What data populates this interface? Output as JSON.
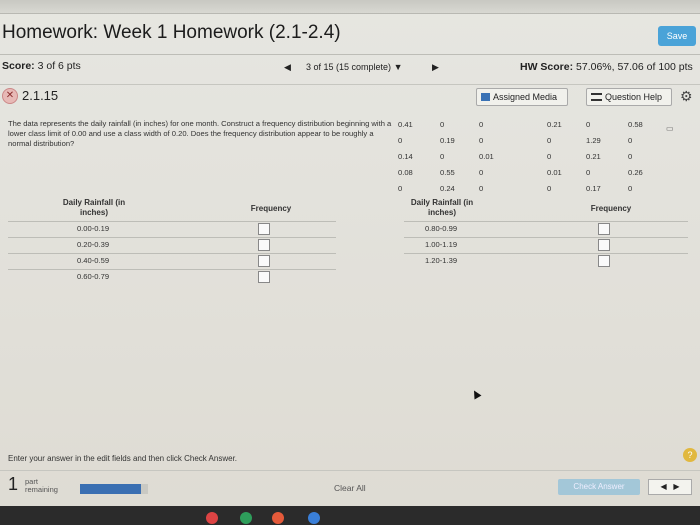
{
  "header": {
    "title": "Homework: Week 1 Homework (2.1-2.4)",
    "save_label": "Save"
  },
  "scorebar": {
    "score_label": "Score:",
    "score_value": "3 of 6 pts",
    "question_selector": "3 of 15 (15 complete)",
    "hw_score_label": "HW Score:",
    "hw_score_value": "57.06%, 57.06 of 100 pts"
  },
  "question_header": {
    "number": "2.1.15",
    "assigned_media_label": "Assigned Media",
    "question_help_label": "Question Help"
  },
  "question": {
    "text": "The data represents the daily rainfall (in inches) for one month. Construct a frequency distribution beginning with a lower class limit of 0.00 and use a class width of 0.20. Does the frequency distribution appear to be roughly a normal distribution?",
    "data_rows": [
      [
        "0.41",
        "0",
        "0",
        "0.21",
        "0",
        "0.58"
      ],
      [
        "0",
        "0.19",
        "0",
        "0",
        "1.29",
        "0"
      ],
      [
        "0.14",
        "0",
        "0.01",
        "0",
        "0.21",
        "0"
      ],
      [
        "0.08",
        "0.55",
        "0",
        "0.01",
        "0",
        "0.26"
      ],
      [
        "0",
        "0.24",
        "0",
        "0",
        "0.17",
        "0"
      ]
    ]
  },
  "frequency_table": {
    "header_class": "Daily Rainfall (in inches)",
    "header_freq": "Frequency",
    "left_classes": [
      "0.00-0.19",
      "0.20-0.39",
      "0.40-0.59",
      "0.60-0.79"
    ],
    "right_classes": [
      "0.80-0.99",
      "1.00-1.19",
      "1.20-1.39"
    ]
  },
  "footer": {
    "instruction": "Enter your answer in the edit fields and then click Check Answer.",
    "parts_number": "1",
    "parts_label_1": "part",
    "parts_label_2": "remaining",
    "clear_all_label": "Clear All",
    "check_answer_label": "Check Answer",
    "progress_fraction": 0.9
  }
}
